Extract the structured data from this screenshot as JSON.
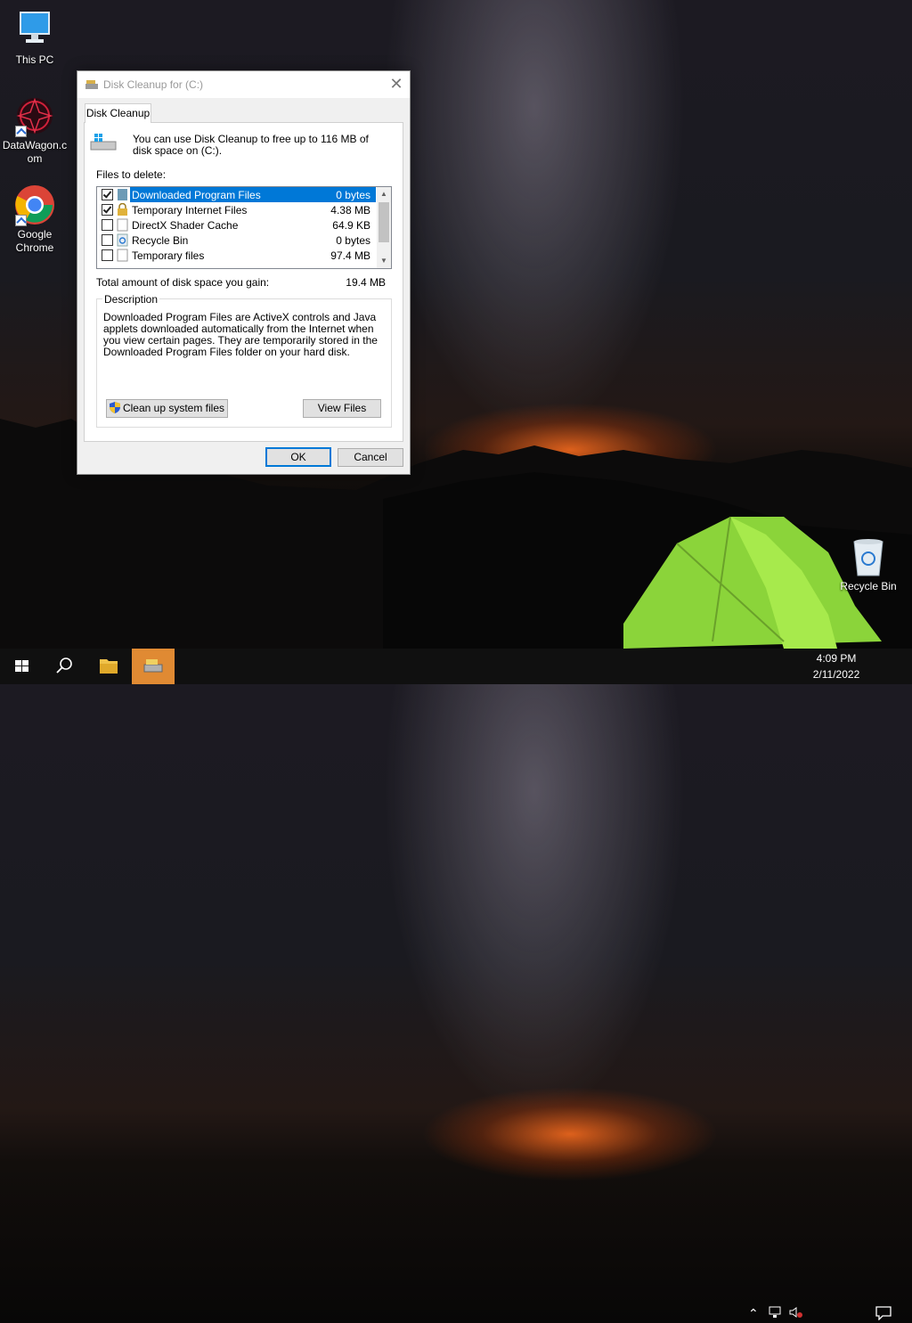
{
  "desktop": {
    "icons": [
      {
        "label": "This PC"
      },
      {
        "label": "DataWagon.com"
      },
      {
        "label": "Google Chrome"
      }
    ],
    "recycle_bin": {
      "label": "Recycle Bin"
    }
  },
  "dialog": {
    "title": "Disk Cleanup for  (C:)",
    "tab": "Disk Cleanup",
    "hint": "You can use Disk Cleanup to free up to 116 MB of disk space on  (C:).",
    "files_label": "Files to delete:",
    "files": [
      {
        "name": "Downloaded Program Files",
        "size": "0 bytes",
        "checked": true,
        "selected": true
      },
      {
        "name": "Temporary Internet Files",
        "size": "4.38 MB",
        "checked": true,
        "selected": false
      },
      {
        "name": "DirectX Shader Cache",
        "size": "64.9 KB",
        "checked": false,
        "selected": false
      },
      {
        "name": "Recycle Bin",
        "size": "0 bytes",
        "checked": false,
        "selected": false
      },
      {
        "name": "Temporary files",
        "size": "97.4 MB",
        "checked": false,
        "selected": false
      }
    ],
    "gain_label": "Total amount of disk space you gain:",
    "gain_value": "19.4 MB",
    "description_title": "Description",
    "description": "Downloaded Program Files are ActiveX controls and Java applets downloaded automatically from the Internet when you view certain pages. They are temporarily stored in the Downloaded Program Files folder on your hard disk.",
    "cleanup_system_label": "Clean up system files",
    "view_files_label": "View Files",
    "ok_label": "OK",
    "cancel_label": "Cancel"
  },
  "taskbar": {
    "time": "4:09 PM",
    "date": "2/11/2022"
  },
  "colors": {
    "accent": "#0078d7",
    "taskbar_active": "#e08a33"
  }
}
